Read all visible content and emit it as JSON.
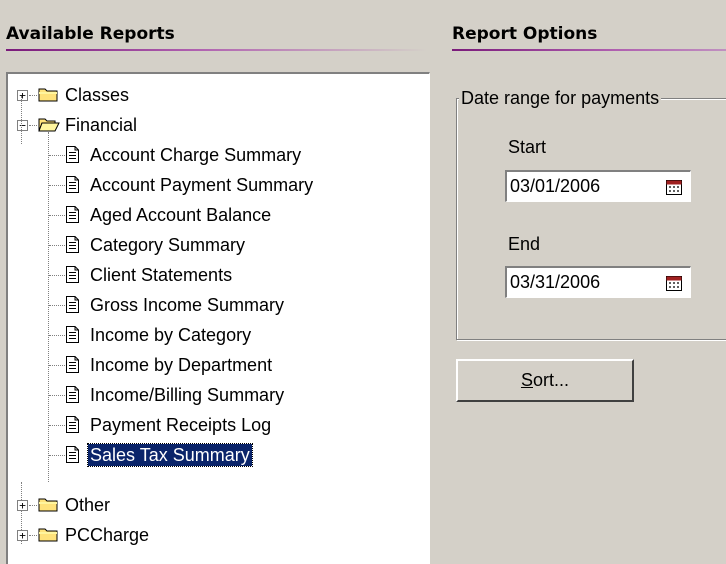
{
  "left_panel": {
    "title": "Available Reports"
  },
  "right_panel": {
    "title": "Report Options"
  },
  "tree": {
    "classes": {
      "label": "Classes",
      "expander": "+"
    },
    "financial": {
      "label": "Financial",
      "expander": "−",
      "items": [
        "Account Charge Summary",
        "Account Payment Summary",
        "Aged Account Balance",
        "Category Summary",
        "Client Statements",
        "Gross Income Summary",
        "Income by Category",
        "Income by Department",
        "Income/Billing Summary",
        "Payment Receipts Log",
        "Sales Tax Summary"
      ],
      "selected": "Sales Tax Summary"
    },
    "other": {
      "label": "Other",
      "expander": "+"
    },
    "pccharge": {
      "label": "PCCharge",
      "expander": "+"
    }
  },
  "date_range": {
    "legend": "Date range for payments",
    "start_label": "Start",
    "start_value": "03/01/2006",
    "end_label": "End",
    "end_value": "03/31/2006"
  },
  "sort_button": {
    "mnemonic": "S",
    "rest": "ort..."
  },
  "colors": {
    "selection": "#0a246a",
    "header_gradient": "#7a1a7a",
    "window_bg": "#d4d0c8"
  }
}
